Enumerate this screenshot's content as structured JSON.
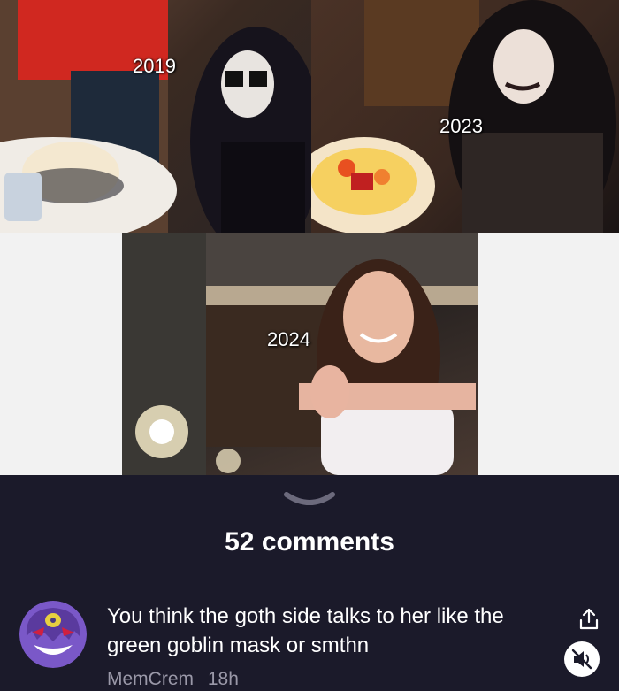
{
  "photos": [
    {
      "year": "2019",
      "icon": "birthday-photo-2019"
    },
    {
      "year": "2023",
      "icon": "birthday-photo-2023"
    },
    {
      "year": "2024",
      "icon": "birthday-photo-2024"
    }
  ],
  "thread": {
    "expand_icon": "chevron-down-icon",
    "comments_label": "52 comments"
  },
  "comment": {
    "avatar_icon": "ghost-avatar-icon",
    "text": "You think the goth side talks to her like the green goblin mask or smthn",
    "author": "MemCrem",
    "time": "18h",
    "share_icon": "share-icon",
    "mute_icon": "mute-icon"
  },
  "colors": {
    "background": "#1b1a2a",
    "text": "#ffffff",
    "muted": "#9a98a8"
  }
}
